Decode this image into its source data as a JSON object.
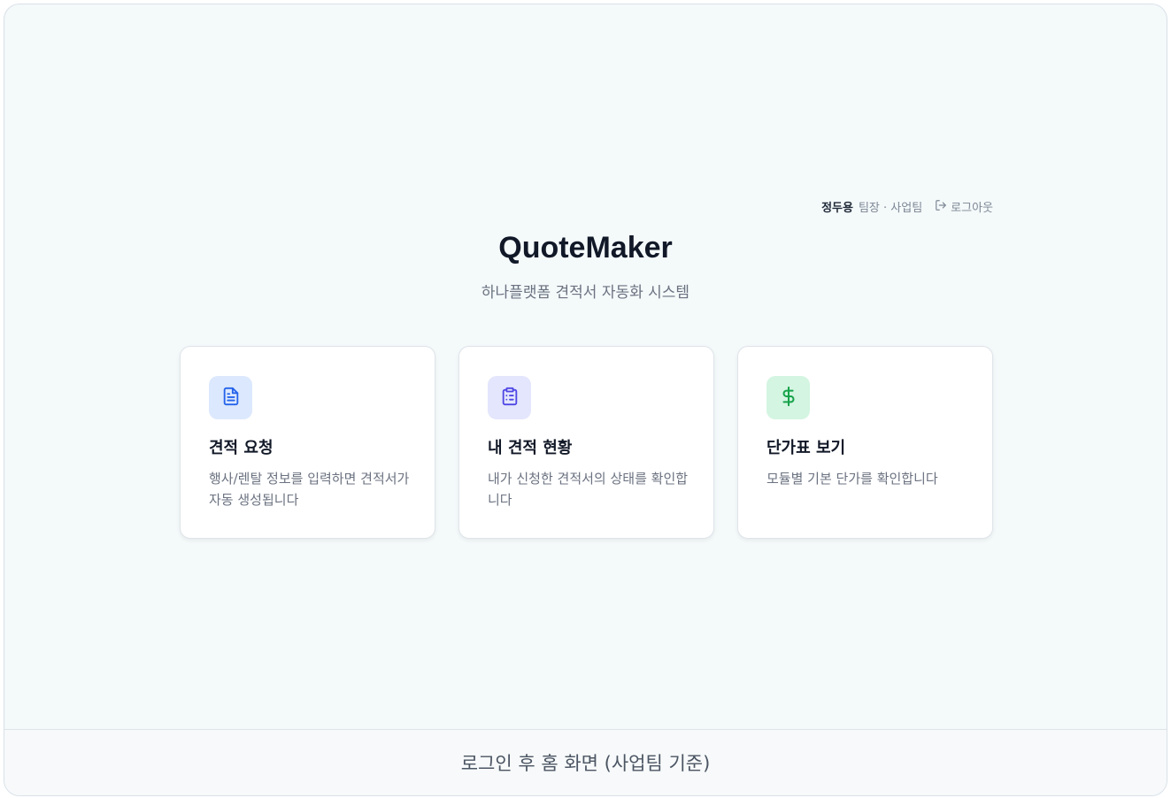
{
  "user": {
    "name": "정두용",
    "role_team": "팀장 · 사업팀",
    "logout_label": "로그아웃"
  },
  "app": {
    "title": "QuoteMaker",
    "subtitle": "하나플랫폼 견적서 자동화 시스템"
  },
  "cards": [
    {
      "title": "견적 요청",
      "description": "행사/렌탈 정보를 입력하면 견적서가 자동 생성됩니다",
      "icon": "document-icon",
      "icon_bg": "#dce8fd",
      "icon_color": "#2563eb"
    },
    {
      "title": "내 견적 현황",
      "description": "내가 신청한 견적서의 상태를 확인합니다",
      "icon": "clipboard-list-icon",
      "icon_bg": "#e3e6fc",
      "icon_color": "#4f46e5"
    },
    {
      "title": "단가표 보기",
      "description": "모듈별 기본 단가를 확인합니다",
      "icon": "dollar-icon",
      "icon_bg": "#d3f5e1",
      "icon_color": "#16a34a"
    }
  ],
  "footer": {
    "caption": "로그인 후 홈 화면 (사업팀 기준)"
  }
}
